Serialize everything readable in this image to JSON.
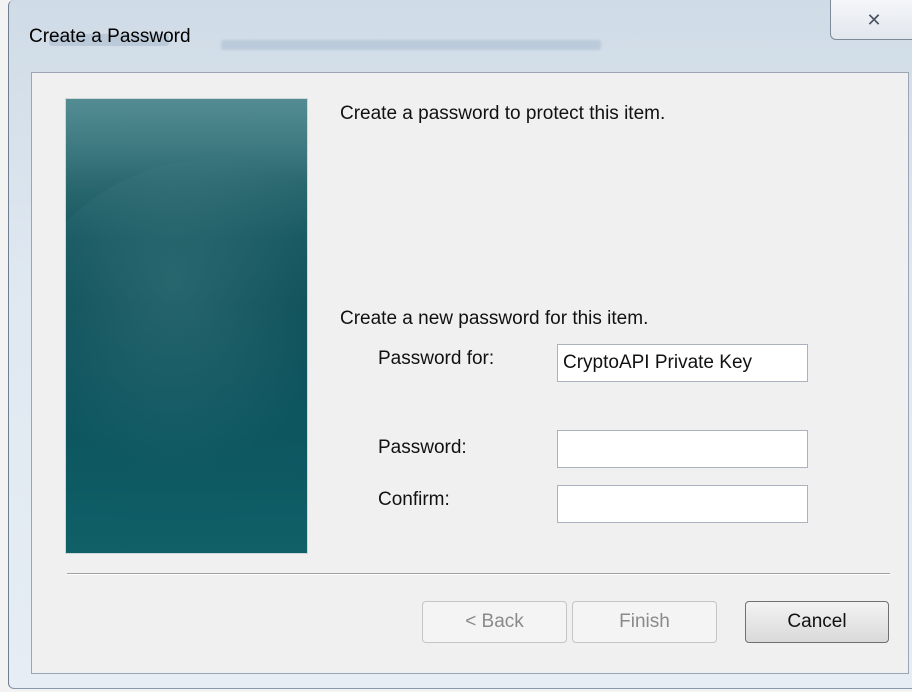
{
  "window": {
    "title": "Create a Password",
    "close_icon": "✕"
  },
  "intro_text": "Create a password to protect this item.",
  "section_text": "Create a new password for this item.",
  "form": {
    "password_for_label": "Password for:",
    "password_for_value": "CryptoAPI Private Key",
    "password_label": "Password:",
    "password_value": "",
    "confirm_label": "Confirm:",
    "confirm_value": ""
  },
  "buttons": {
    "back": "< Back",
    "finish": "Finish",
    "cancel": "Cancel"
  },
  "icons": {
    "close": "close-icon"
  }
}
